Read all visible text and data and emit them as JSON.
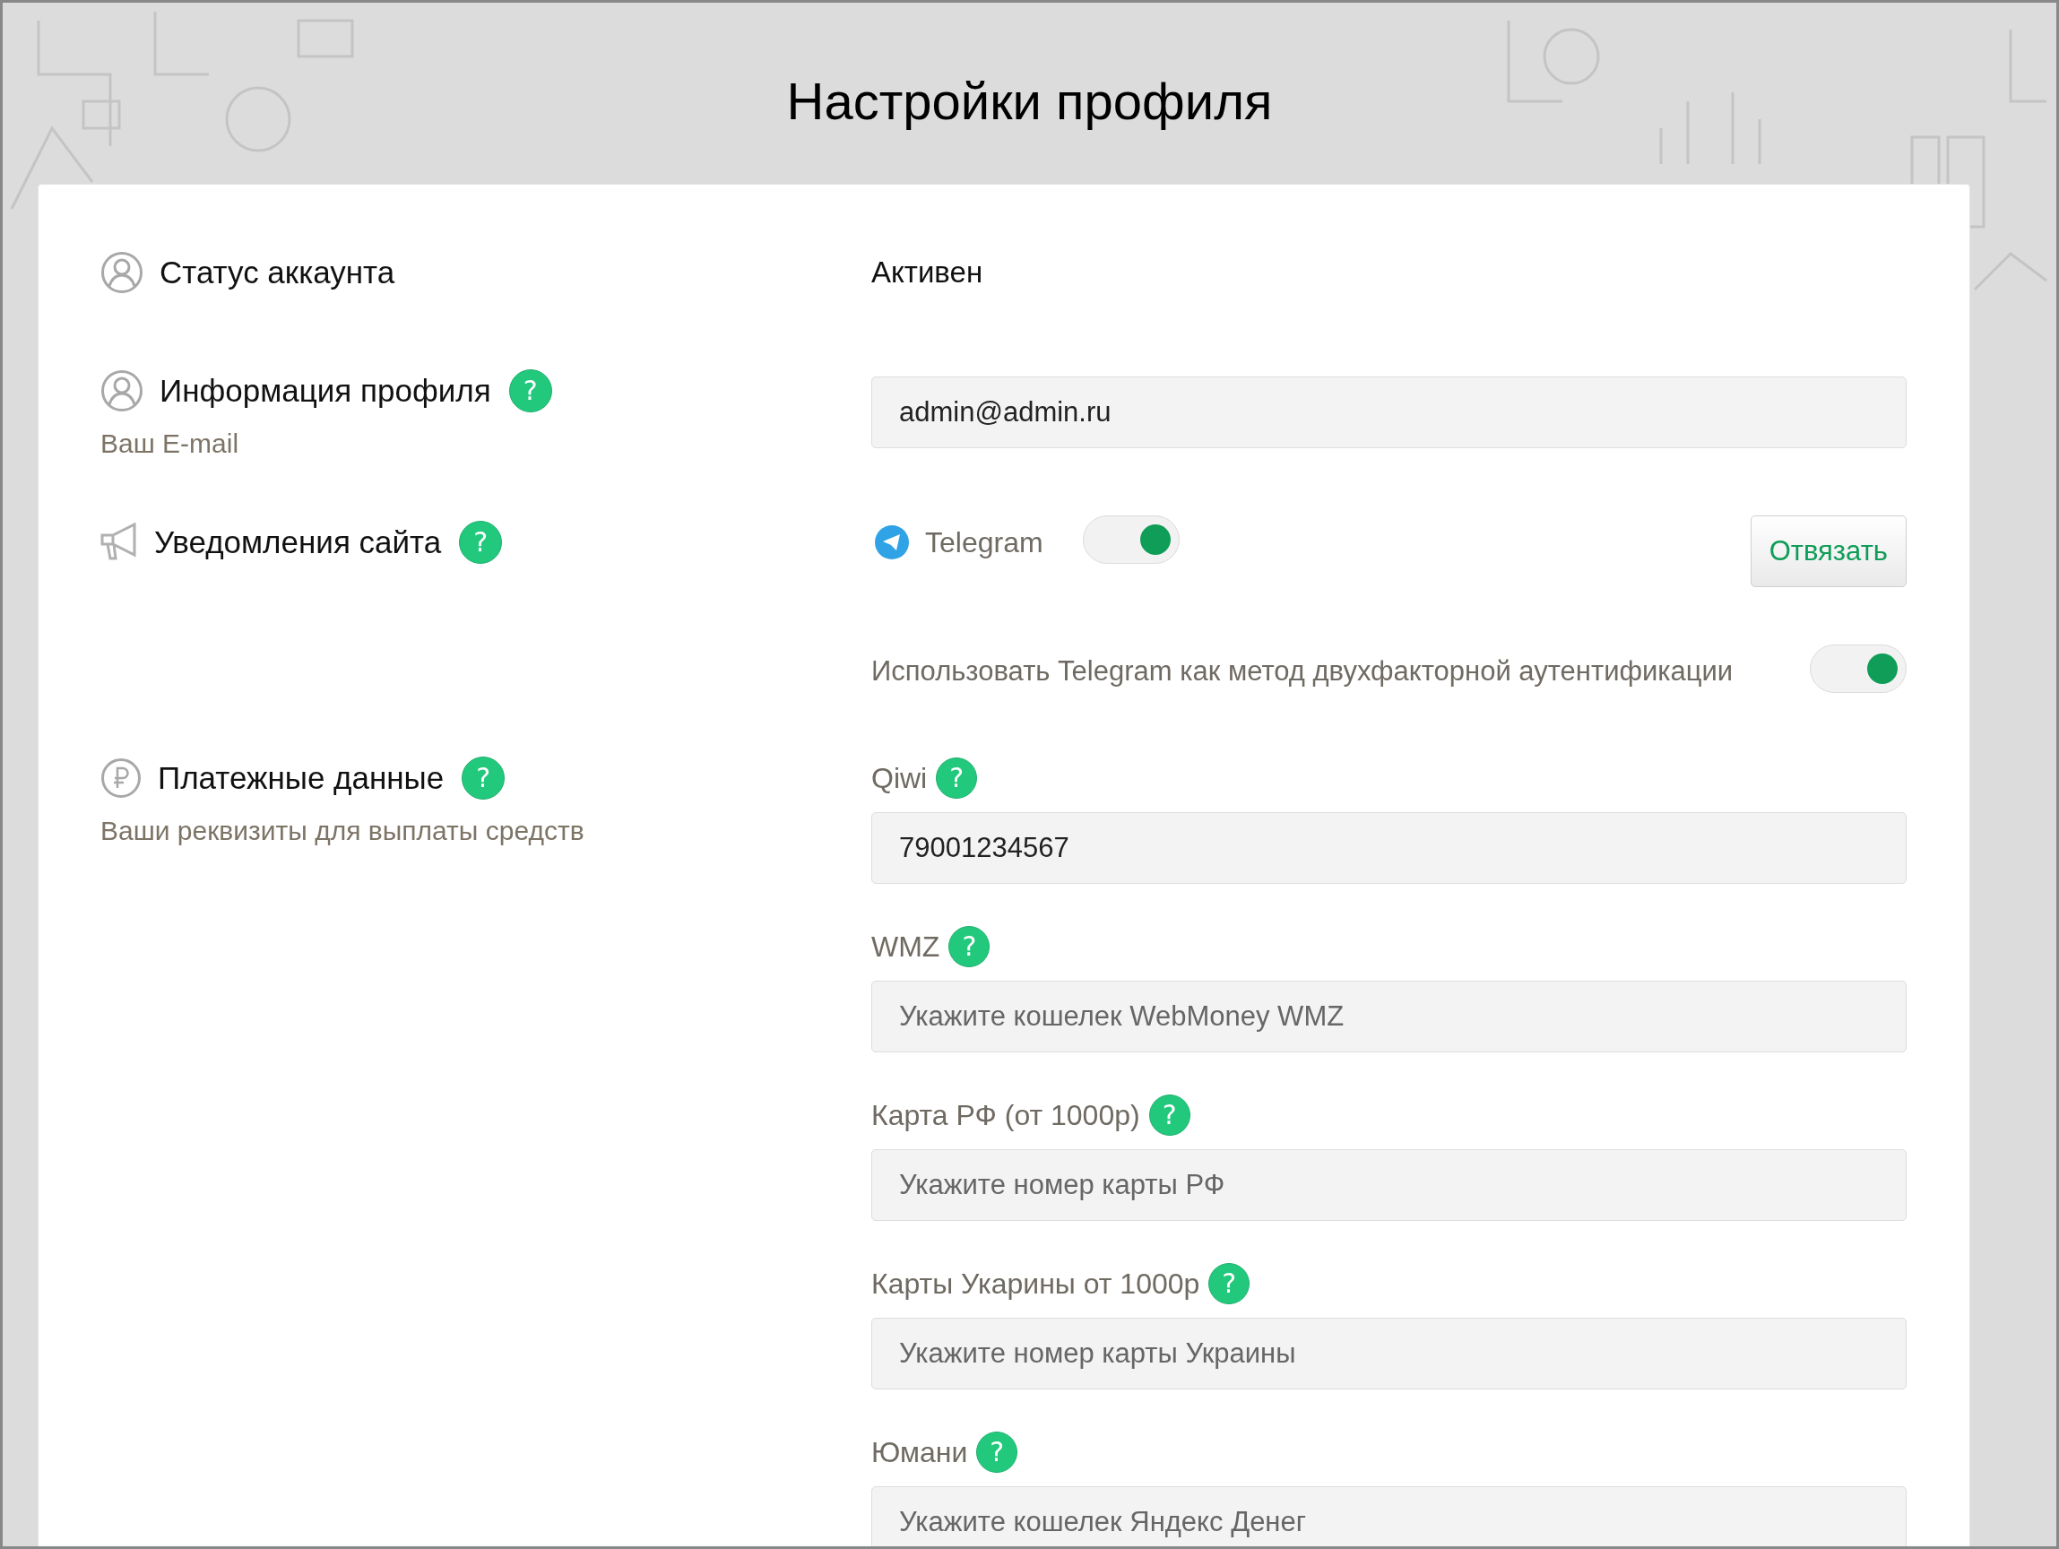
{
  "title": "Настройки профиля",
  "sections": [
    {
      "kind": "status",
      "label": "Статус аккаунта",
      "value": "Активен"
    },
    {
      "kind": "email",
      "label": "Информация профиля",
      "help": "?",
      "sublabel": "Ваш E-mail",
      "field": {
        "value": "admin@admin.ru"
      }
    },
    {
      "kind": "notifications",
      "label": "Уведомления сайта",
      "help": "?",
      "telegram": {
        "label": "Telegram",
        "on": true,
        "button": "Отвязать"
      },
      "two_factor": {
        "label": "Использовать Telegram как метод двухфакторной аутентификации",
        "on": true
      }
    },
    {
      "kind": "payments",
      "label": "Платежные данные",
      "help": "?",
      "sublabel": "Ваши реквизиты для выплаты средств",
      "fields": [
        {
          "label": "Qiwi",
          "help": "?",
          "value": "79001234567"
        },
        {
          "label": "WMZ",
          "help": "?",
          "placeholder": "Укажите кошелек WebMoney WMZ"
        },
        {
          "label": "Карта РФ (от 1000р)",
          "help": "?",
          "placeholder": "Укажите номер карты РФ"
        },
        {
          "label": "Карты Укарины от 1000р",
          "help": "?",
          "placeholder": "Укажите номер карты Украины"
        },
        {
          "label": "Юмани",
          "help": "?",
          "placeholder": "Укажите кошелек Яндекс Денег"
        }
      ]
    }
  ]
}
